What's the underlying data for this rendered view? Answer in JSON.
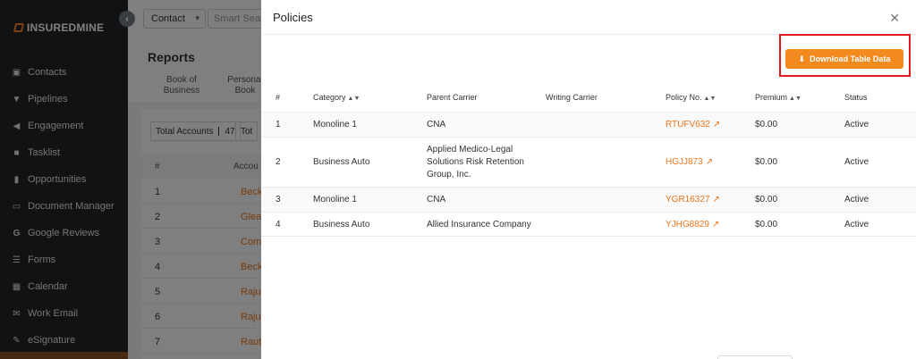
{
  "sidebar": {
    "logo_text": "INSUREDMINE",
    "collapse_icon": "chevron-left-icon",
    "items": [
      {
        "label": "Contacts",
        "icon": "contacts-icon"
      },
      {
        "label": "Pipelines",
        "icon": "funnel-icon"
      },
      {
        "label": "Engagement",
        "icon": "megaphone-icon"
      },
      {
        "label": "Tasklist",
        "icon": "tasklist-icon"
      },
      {
        "label": "Opportunities",
        "icon": "chart-icon"
      },
      {
        "label": "Document Manager",
        "icon": "folder-icon"
      },
      {
        "label": "Google Reviews",
        "icon": "google-icon"
      },
      {
        "label": "Forms",
        "icon": "forms-icon"
      },
      {
        "label": "Calendar",
        "icon": "calendar-icon"
      },
      {
        "label": "Work Email",
        "icon": "mail-icon"
      },
      {
        "label": "eSignature",
        "icon": "signature-icon"
      }
    ]
  },
  "background": {
    "contact_select": "Contact",
    "search_placeholder": "Smart Search",
    "reports_title": "Reports",
    "tabs": [
      "Book of Business",
      "Personal Book"
    ],
    "total_accounts_label": "Total Accounts",
    "total_accounts_value": "47",
    "second_count_label": "Tot",
    "table_headers": [
      "#",
      "Accou"
    ],
    "rows": [
      {
        "num": "1",
        "name": "Beck"
      },
      {
        "num": "2",
        "name": "Glea"
      },
      {
        "num": "3",
        "name": "Com"
      },
      {
        "num": "4",
        "name": "Beck"
      },
      {
        "num": "5",
        "name": "Raju"
      },
      {
        "num": "6",
        "name": "Raju"
      },
      {
        "num": "7",
        "name": "Raut"
      }
    ]
  },
  "modal": {
    "title": "Policies",
    "close_icon": "close-icon",
    "download_label": "Download Table Data",
    "download_icon": "download-icon",
    "headers": {
      "num": "#",
      "category": "Category",
      "parent_carrier": "Parent Carrier",
      "writing_carrier": "Writing Carrier",
      "policy_no": "Policy No.",
      "premium": "Premium",
      "status": "Status"
    },
    "rows": [
      {
        "num": "1",
        "category": "Monoline 1",
        "parent_carrier": "CNA",
        "writing_carrier": "",
        "policy_no": "RTUFV632",
        "premium": "$0.00",
        "status": "Active"
      },
      {
        "num": "2",
        "category": "Business Auto",
        "parent_carrier": "Applied Medico-Legal Solutions Risk Retention Group, Inc.",
        "writing_carrier": "",
        "policy_no": "HGJJ873",
        "premium": "$0.00",
        "status": "Active"
      },
      {
        "num": "3",
        "category": "Monoline 1",
        "parent_carrier": "CNA",
        "writing_carrier": "",
        "policy_no": "YGR16327",
        "premium": "$0.00",
        "status": "Active"
      },
      {
        "num": "4",
        "category": "Business Auto",
        "parent_carrier": "Allied Insurance Company",
        "writing_carrier": "",
        "policy_no": "YJHG8829",
        "premium": "$0.00",
        "status": "Active"
      }
    ]
  },
  "colors": {
    "accent": "#f28a20",
    "link": "#e8761c",
    "highlight_border": "#e0191f",
    "sidebar_bg": "#1f2226"
  }
}
